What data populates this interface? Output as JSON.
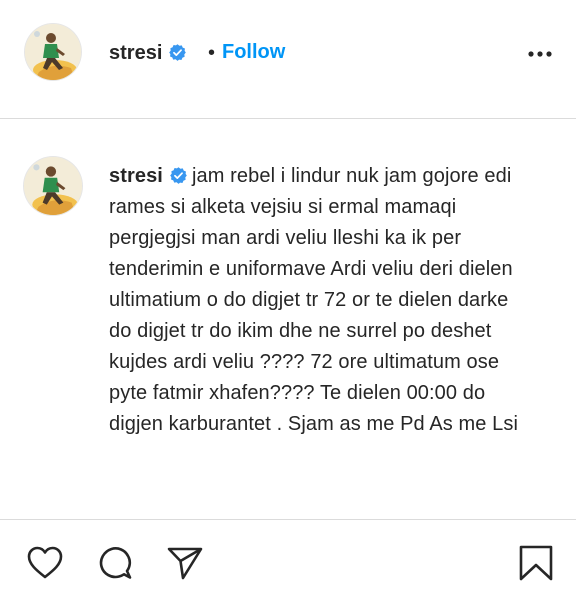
{
  "post": {
    "username": "stresi",
    "follow_label": "Follow",
    "separator": "•",
    "caption_username": "stresi",
    "caption_text": "jam rebel i lindur nuk jam gojore edi rames si alketa vejsiu si ermal mamaqi pergjegjsi man ardi veliu lleshi ka ik per tenderimin e uniformave Ardi veliu deri dielen ultimatium o do digjet tr 72 or te dielen darke do digjet tr do ikim dhe ne surrel po deshet kujdes ardi veliu ???? 72 ore ultimatum ose pyte fatmir xhafen???? Te dielen 00:00 do digjen karburantet . Sjam as me Pd As me Lsi"
  },
  "icons": {
    "verified": "verified-badge-icon",
    "more": "more-options-icon",
    "like": "heart-icon",
    "comment": "comment-bubble-icon",
    "share": "paper-plane-icon",
    "save": "bookmark-icon"
  },
  "colors": {
    "accent": "#0095f6",
    "text": "#262626",
    "border": "#dbdbdb"
  }
}
